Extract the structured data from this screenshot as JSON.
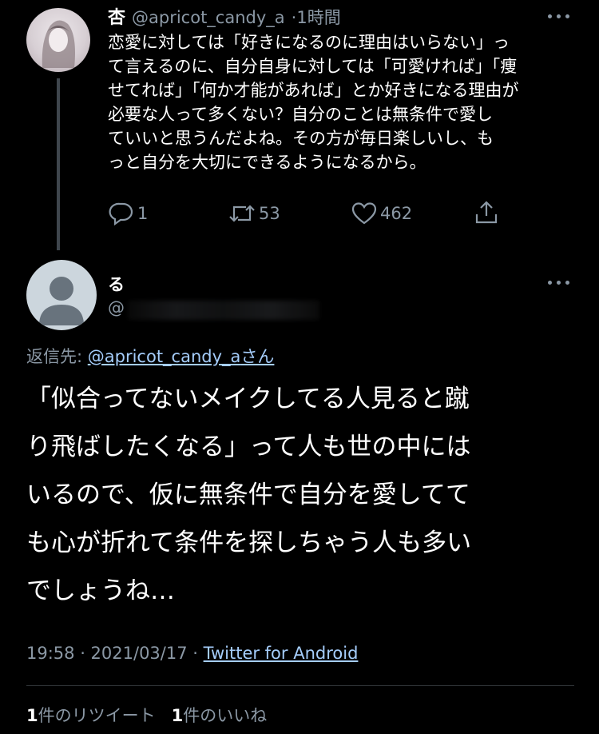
{
  "parent_tweet": {
    "name": "杏",
    "handle": "@apricot_candy_a",
    "time": "1時間",
    "text": "恋愛に対しては「好きになるのに理由はいらない」っ\nて言えるのに、自分自身に対しては「可愛ければ」「痩\nせてれば」「何か才能があれば」とか好きになる理由が\n必要な人って多くない？自分のことは無条件で愛し\nていいと思うんだよね。その方が毎日楽しいし、も\nっと自分を大切にできるようになるから。",
    "replies": "1",
    "retweets": "53",
    "likes": "462"
  },
  "reply_tweet": {
    "name": "る",
    "handle": "@",
    "replying_to_prefix": "返信先: ",
    "replying_to_handle": "@apricot_candy_a",
    "replying_to_suffix": "さん",
    "text": "「似合ってないメイクしてる人見ると蹴\nり飛ばしたくなる」って人も世の中には\nいるので、仮に無条件で自分を愛してて\nも心が折れて条件を探しちゃう人も多い\nでしょうね…",
    "timestamp": "19:58 · 2021/03/17 · ",
    "source": "Twitter for Android"
  },
  "stats": {
    "retweet_count": "1",
    "retweet_label": "件のリツイート",
    "like_count": "1",
    "like_label": "件のいいね"
  },
  "icons": {
    "reply": "reply-icon",
    "retweet": "retweet-icon",
    "like": "heart-icon",
    "share": "share-icon",
    "more": "more-icon"
  }
}
